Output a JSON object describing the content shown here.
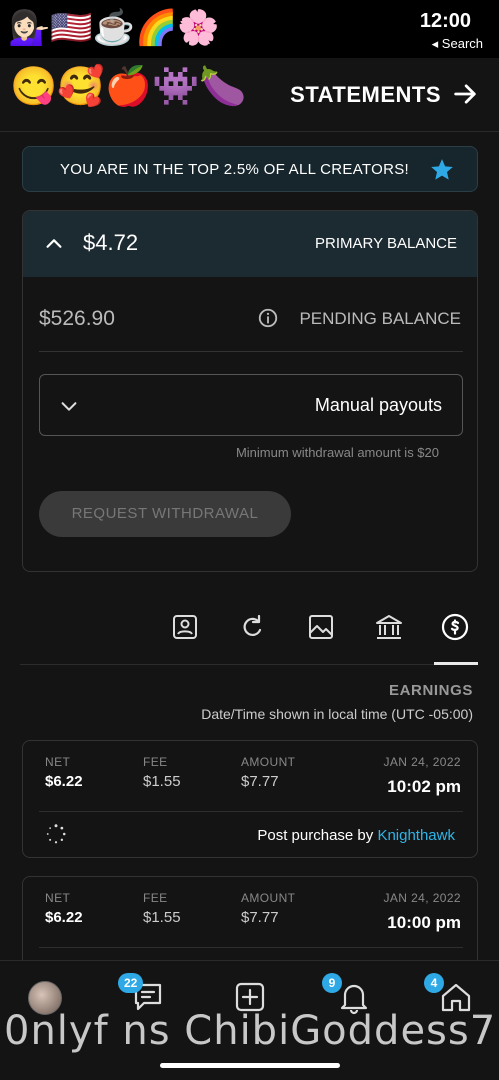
{
  "status_bar": {
    "emojis": "💁🏻‍♀️🇺🇸☕🌈🌸",
    "time": "12:00",
    "back_label": "◂ Search"
  },
  "header": {
    "emojis": "😋🥰🍎👾🍆",
    "title": "STATEMENTS"
  },
  "banner": {
    "text": "YOU ARE IN THE TOP 2.5% OF ALL CREATORS!",
    "icon": "star-icon",
    "accent": "#2fa9e6"
  },
  "balance": {
    "primary_label": "PRIMARY BALANCE",
    "primary_amount": "$4.72",
    "pending_label": "PENDING BALANCE",
    "pending_amount": "$526.90",
    "payout_mode": "Manual payouts",
    "min_hint": "Minimum withdrawal amount is $20",
    "request_button": "REQUEST WITHDRAWAL"
  },
  "tabs": [
    {
      "name": "earnings",
      "icon": "dollar-circle-icon"
    },
    {
      "name": "payouts",
      "icon": "bank-icon"
    },
    {
      "name": "media",
      "icon": "image-icon"
    },
    {
      "name": "refunds",
      "icon": "refresh-icon"
    },
    {
      "name": "referrals",
      "icon": "user-card-icon"
    }
  ],
  "earnings": {
    "title": "EARNINGS",
    "subtitle": "Date/Time shown in local time (UTC -05:00)",
    "columns": {
      "date": "JAN 24, 2022",
      "amount": "AMOUNT",
      "fee": "FEE",
      "net": "NET"
    },
    "rows": [
      {
        "date": "JAN 24, 2022",
        "time": "10:02 pm",
        "amount": "$7.77",
        "fee": "$1.55",
        "net": "$6.22",
        "desc_prefix": "Post purchase by",
        "desc_user": "Knighthawk"
      },
      {
        "date": "JAN 24, 2022",
        "time": "10:00 pm",
        "amount": "$7.77",
        "fee": "$1.55",
        "net": "$6.22"
      }
    ]
  },
  "bottom_nav": {
    "home_badge": "4",
    "notifications_badge": "9",
    "messages_badge": "22",
    "watermark": "0nlyf ns ChibiGoddess7"
  }
}
